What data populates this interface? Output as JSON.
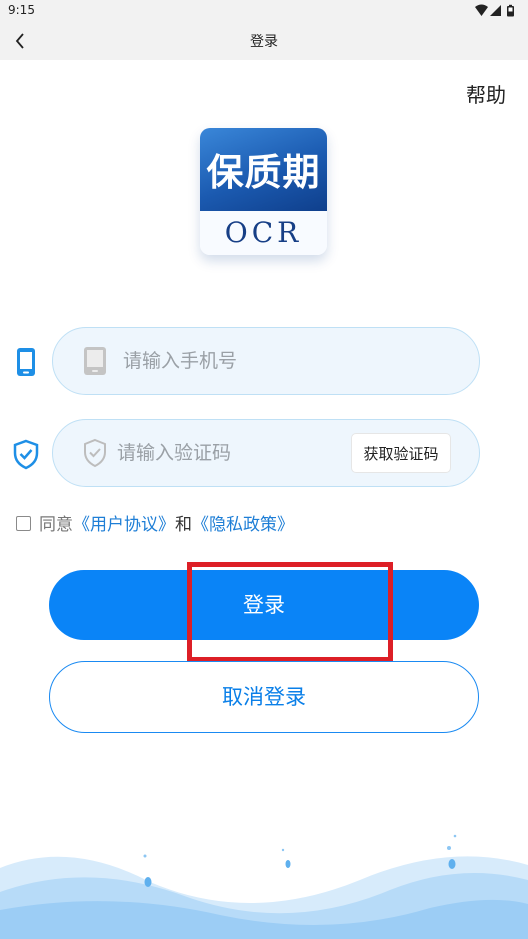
{
  "status_bar": {
    "time": "9:15"
  },
  "nav": {
    "title": "登录"
  },
  "help": {
    "label": "帮助"
  },
  "logo": {
    "title": "保质期",
    "subtitle": "OCR"
  },
  "phone_field": {
    "placeholder": "请输入手机号",
    "value": ""
  },
  "code_field": {
    "placeholder": "请输入验证码",
    "value": "",
    "get_code_label": "获取验证码"
  },
  "agreement": {
    "prefix": "同意",
    "user_agreement": "《用户协议》",
    "conjunction": "和",
    "privacy_policy": "《隐私政策》",
    "checked": false
  },
  "login_button": {
    "label": "登录"
  },
  "cancel_button": {
    "label": "取消登录"
  },
  "colors": {
    "primary": "#0a84f7",
    "link": "#1e7ed6",
    "highlight": "#dd1f26",
    "logo_blue": "#1b5ab0"
  },
  "icons": {
    "status": [
      "wifi-icon",
      "signal-icon",
      "battery-icon"
    ],
    "back": "chevron-left-icon",
    "phone_side": "mobile-phone-icon",
    "shield_side": "shield-check-icon",
    "phone_field": "phone-outline-icon",
    "code_field": "shield-outline-icon"
  }
}
